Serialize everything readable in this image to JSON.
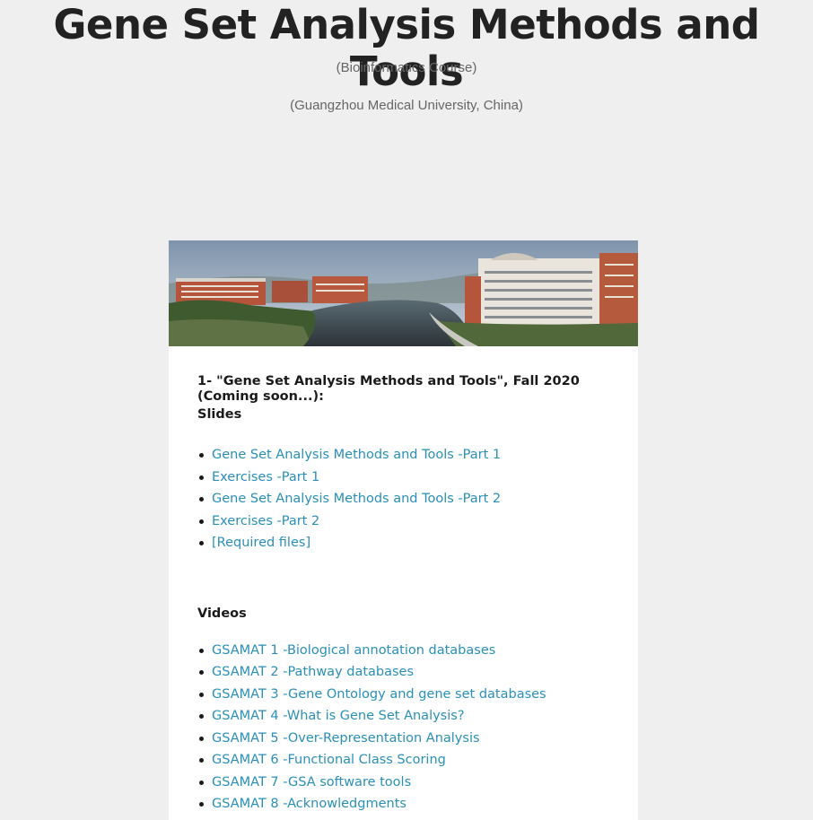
{
  "header": {
    "title": "Gene Set Analysis Methods and Tools",
    "subtitle_course": "(Bioinformatics Course)",
    "subtitle_university": "(Guangzhou Medical University, China)"
  },
  "banner": {
    "icon": "campus-photo"
  },
  "course": {
    "heading": "1- \"Gene Set Analysis Methods and Tools\", Fall 2020 (Coming soon...):",
    "slides_label": "Slides",
    "slides": [
      "Gene Set Analysis Methods and Tools -Part 1",
      "Exercises -Part 1",
      "Gene Set Analysis Methods and Tools -Part 2",
      "Exercises -Part 2",
      "[Required files]"
    ],
    "videos_label": "Videos",
    "videos": [
      "GSAMAT 1 -Biological annotation databases",
      "GSAMAT 2 -Pathway databases",
      "GSAMAT 3 -Gene Ontology and gene set databases",
      "GSAMAT 4 -What is Gene Set Analysis?",
      "GSAMAT 5 -Over-Representation Analysis",
      "GSAMAT 6 -Functional Class Scoring",
      "GSAMAT 7 -GSA software tools",
      "GSAMAT 8 -Acknowledgments"
    ]
  },
  "colors": {
    "background": "#efefef",
    "link": "#2a8fb8",
    "card": "#ffffff"
  }
}
